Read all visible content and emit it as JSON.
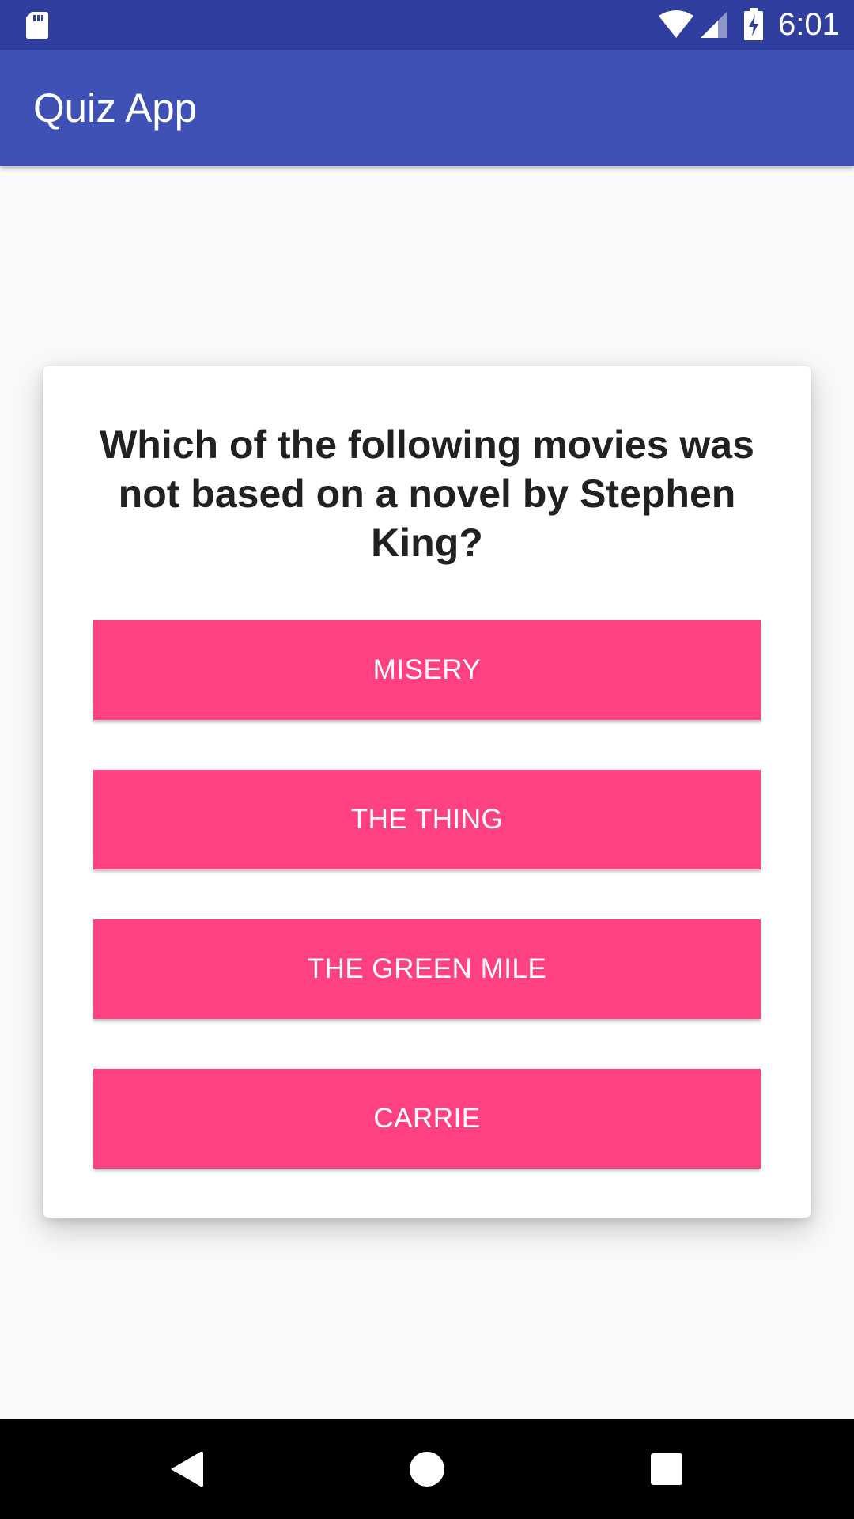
{
  "status_bar": {
    "time": "6:01",
    "icons": [
      "sd-card-icon",
      "wifi-icon",
      "cell-signal-icon",
      "battery-charging-icon"
    ]
  },
  "app_bar": {
    "title": "Quiz App",
    "color": "#3f51b5"
  },
  "quiz": {
    "question": "Which of the following movies was not based on a novel by Stephen King?",
    "answers": [
      {
        "label": "MISERY"
      },
      {
        "label": "THE THING"
      },
      {
        "label": "THE GREEN MILE"
      },
      {
        "label": "CARRIE"
      }
    ],
    "accent_color": "#ff4081"
  },
  "nav_bar": {
    "icons": [
      "back-icon",
      "home-icon",
      "recents-icon"
    ]
  }
}
